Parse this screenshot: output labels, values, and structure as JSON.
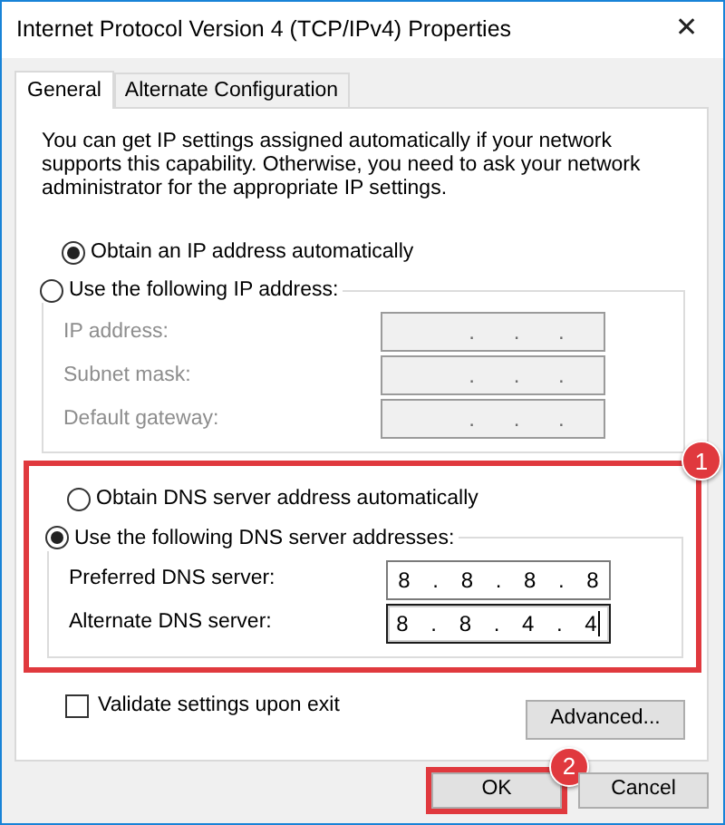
{
  "window": {
    "title": "Internet Protocol Version 4 (TCP/IPv4) Properties",
    "close": "✕"
  },
  "tabs": [
    {
      "label": "General",
      "selected": true
    },
    {
      "label": "Alternate Configuration",
      "selected": false
    }
  ],
  "description": "You can get IP settings assigned automatically if your network supports this capability. Otherwise, you need to ask your network administrator for the appropriate IP settings.",
  "ip_options": [
    {
      "label": "Obtain an IP address automatically",
      "selected": true
    },
    {
      "label": "Use the following IP address:",
      "selected": false
    }
  ],
  "ip_fields": [
    {
      "label": "IP address:",
      "value": ". . .",
      "disabled": true,
      "focused": false
    },
    {
      "label": "Subnet mask:",
      "value": ". . .",
      "disabled": true,
      "focused": false
    },
    {
      "label": "Default gateway:",
      "value": ". . .",
      "disabled": true,
      "focused": false
    }
  ],
  "dns_section": {
    "badge": "1",
    "options": [
      {
        "label": "Obtain DNS server address automatically",
        "selected": false
      },
      {
        "label": "Use the following DNS server addresses:",
        "selected": true
      }
    ],
    "fields": [
      {
        "label": "Preferred DNS server:",
        "value": "8 . 8 . 8 . 8",
        "disabled": false,
        "focused": false
      },
      {
        "label": "Alternate DNS server:",
        "value": "8 . 8 . 4 . 4",
        "disabled": false,
        "focused": true
      }
    ]
  },
  "validate": {
    "label": "Validate settings upon exit",
    "checked": false
  },
  "advanced_button": "Advanced...",
  "buttons": [
    {
      "label": "OK",
      "highlighted": true,
      "badge": "2"
    },
    {
      "label": "Cancel",
      "highlighted": false
    }
  ]
}
